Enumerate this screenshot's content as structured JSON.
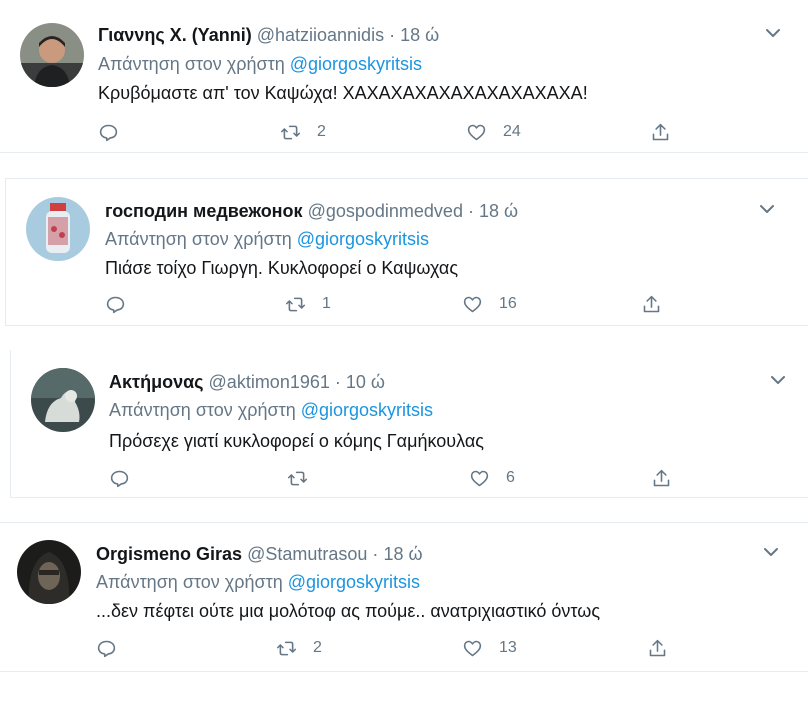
{
  "reply_prefix": "Απάντηση στον χρήστη",
  "tweets": [
    {
      "name": "Γιαννης Χ. (Yanni)",
      "handle": "@hatziioannidis",
      "time": "18 ώ",
      "reply_to": "@giorgoskyritsis",
      "text": "Κρυβόμαστε απ' τον Καψώχα! ΧΑΧΑΧΑΧΑΧΑΧΑΧΑΧΑΧΑΧΑ!",
      "replies": "",
      "retweets": "2",
      "likes": "24"
    },
    {
      "name": "господин медвежонок",
      "handle": "@gospodinmedved",
      "time": "18 ώ",
      "reply_to": "@giorgoskyritsis",
      "text": "Πιάσε τοίχο Γιωργη. Κυκλοφορεί ο Καψωχας",
      "replies": "",
      "retweets": "1",
      "likes": "16"
    },
    {
      "name": "Ακτήμονας",
      "handle": "@aktimon1961",
      "time": "10 ώ",
      "reply_to": "@giorgoskyritsis",
      "text": "Πρόσεχε γιατί κυκλοφορεί ο κόμης Γαμήκουλας",
      "replies": "",
      "retweets": "",
      "likes": "6"
    },
    {
      "name": "Orgismeno Giras",
      "handle": "@Stamutrasou",
      "time": "18 ώ",
      "reply_to": "@giorgoskyritsis",
      "text": "...δεν πέφτει ούτε μια μολότοφ ας πούμε.. ανατριχιαστικό όντως",
      "replies": "",
      "retweets": "2",
      "likes": "13"
    }
  ],
  "dot": "·",
  "icons": {
    "reply": "reply-icon",
    "retweet": "retweet-icon",
    "like": "heart-icon",
    "share": "share-icon",
    "more": "chevron-down-icon"
  },
  "colors": {
    "text": "#14171a",
    "muted": "#657786",
    "link": "#1b95e0",
    "border": "#e6ecf0"
  }
}
